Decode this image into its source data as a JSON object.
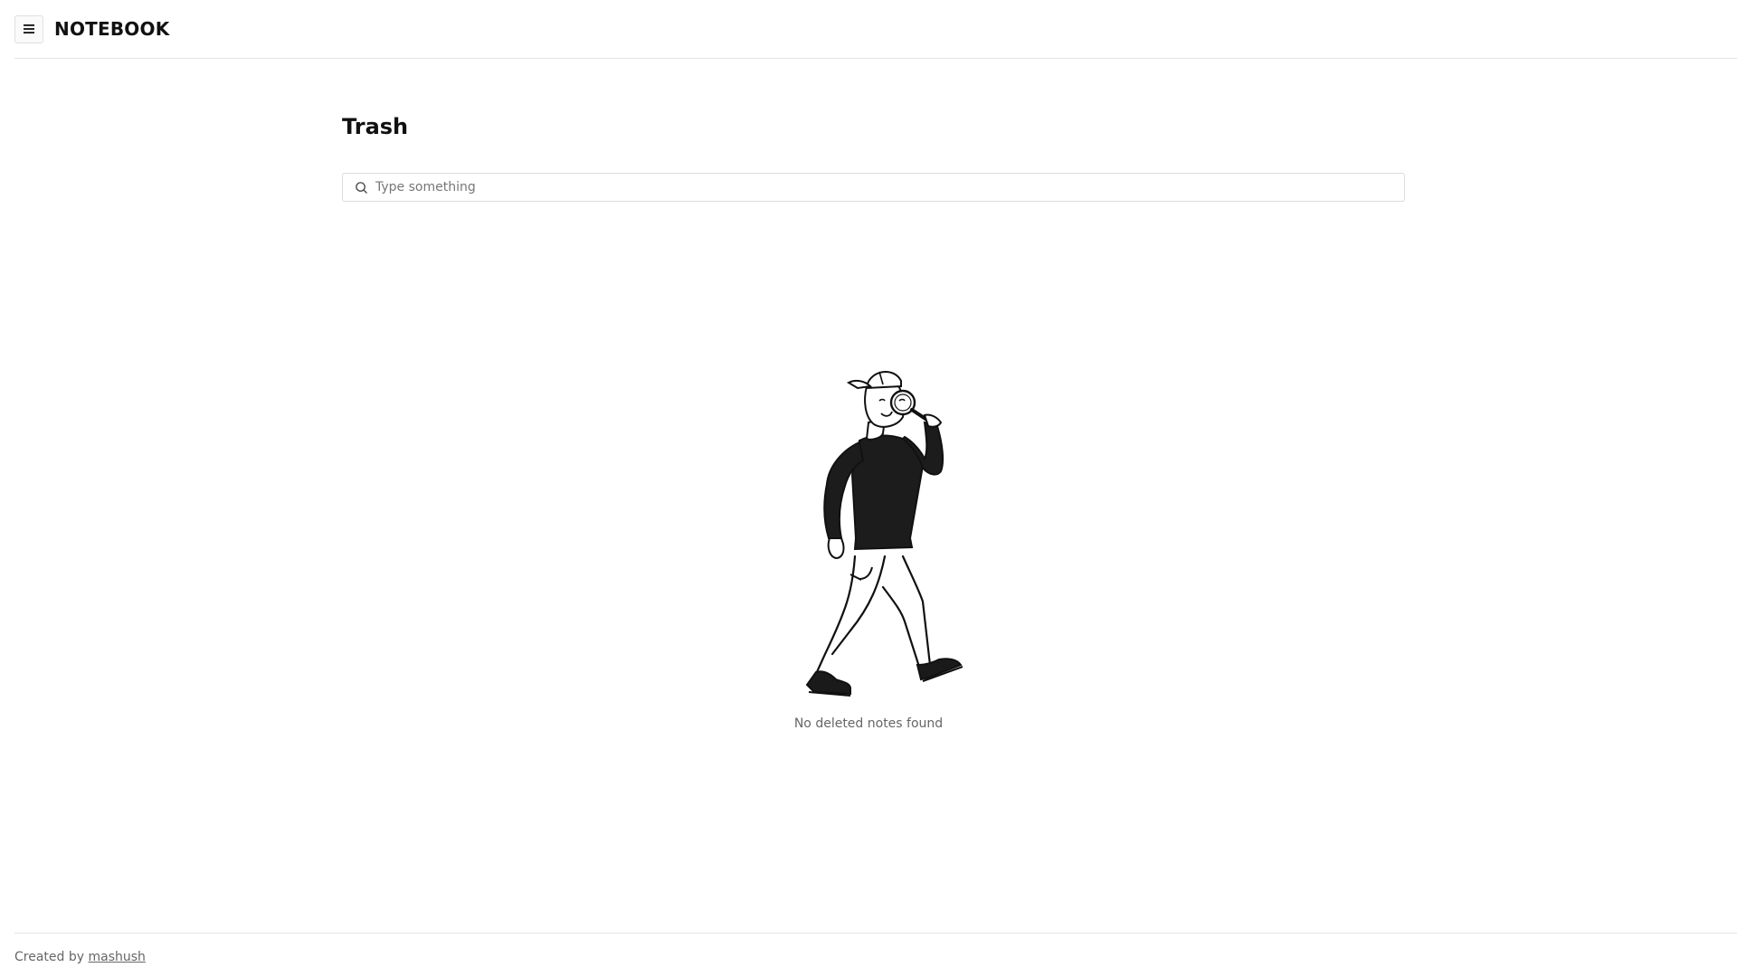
{
  "header": {
    "menu_icon": "hamburger-menu-icon",
    "brand": "NOTEBOOK"
  },
  "main": {
    "title": "Trash",
    "search": {
      "placeholder": "Type something",
      "value": "",
      "icon": "search-icon"
    },
    "empty_state": {
      "illustration": "person-with-magnifying-glass",
      "message": "No deleted notes found"
    }
  },
  "footer": {
    "prefix": "Created by",
    "author": "mashush"
  },
  "colors": {
    "background": "#ffffff",
    "text": "#111111",
    "muted": "#666666",
    "border": "#e3e3e3"
  }
}
